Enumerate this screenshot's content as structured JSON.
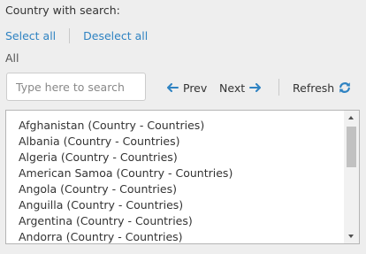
{
  "header": {
    "title": "Country with search:"
  },
  "selection": {
    "select_all": "Select all",
    "deselect_all": "Deselect all"
  },
  "filter": {
    "label": "All"
  },
  "search": {
    "placeholder": "Type here to search",
    "value": ""
  },
  "pager": {
    "prev_label": "Prev",
    "next_label": "Next",
    "refresh_label": "Refresh"
  },
  "icons": {
    "prev": "arrow-left-icon",
    "next": "arrow-right-icon",
    "refresh": "refresh-icon"
  },
  "colors": {
    "link": "#2f83c2",
    "icon": "#2f83c2",
    "background": "#eeeeee"
  },
  "list": {
    "items": [
      "Afghanistan (Country - Countries)",
      "Albania (Country - Countries)",
      "Algeria (Country - Countries)",
      "American Samoa (Country - Countries)",
      "Angola (Country - Countries)",
      "Anguilla (Country - Countries)",
      "Argentina (Country - Countries)",
      "Andorra (Country - Countries)"
    ]
  }
}
